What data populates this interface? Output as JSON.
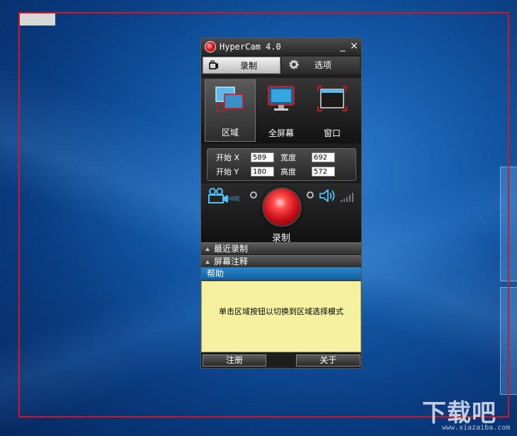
{
  "app": {
    "title": "HyperCam 4.0",
    "minimize_glyph": "_",
    "close_glyph": "×"
  },
  "tabs": [
    {
      "label": "录制",
      "icon": "camera-icon",
      "active": true
    },
    {
      "label": "选项",
      "icon": "gear-icon",
      "active": false
    }
  ],
  "modes": [
    {
      "label": "区域",
      "icon": "region-icon",
      "active": true
    },
    {
      "label": "全屏幕",
      "icon": "monitor-icon",
      "active": false
    },
    {
      "label": "窗口",
      "icon": "window-icon",
      "active": false
    }
  ],
  "coords": {
    "start_x_label": "开始 X",
    "start_x": "589",
    "start_y_label": "开始 Y",
    "start_y": "180",
    "width_label": "宽度",
    "width": "692",
    "height_label": "高度",
    "height": "572"
  },
  "record": {
    "label": "录制"
  },
  "sections": [
    {
      "label": "最近录制"
    },
    {
      "label": "屏幕注释"
    }
  ],
  "help": {
    "title": "帮助",
    "text": "单击区域按钮以切换到区域选择模式"
  },
  "buttons": {
    "register": "注册",
    "about": "关于"
  },
  "watermark": {
    "logo_text": "下载吧",
    "url": "www.xiazaiba.com"
  },
  "colors": {
    "selection_frame": "#d8141c",
    "record_red": "#e0202a",
    "help_bg": "#f6f1a0",
    "help_bar": "#1a6fb0"
  }
}
